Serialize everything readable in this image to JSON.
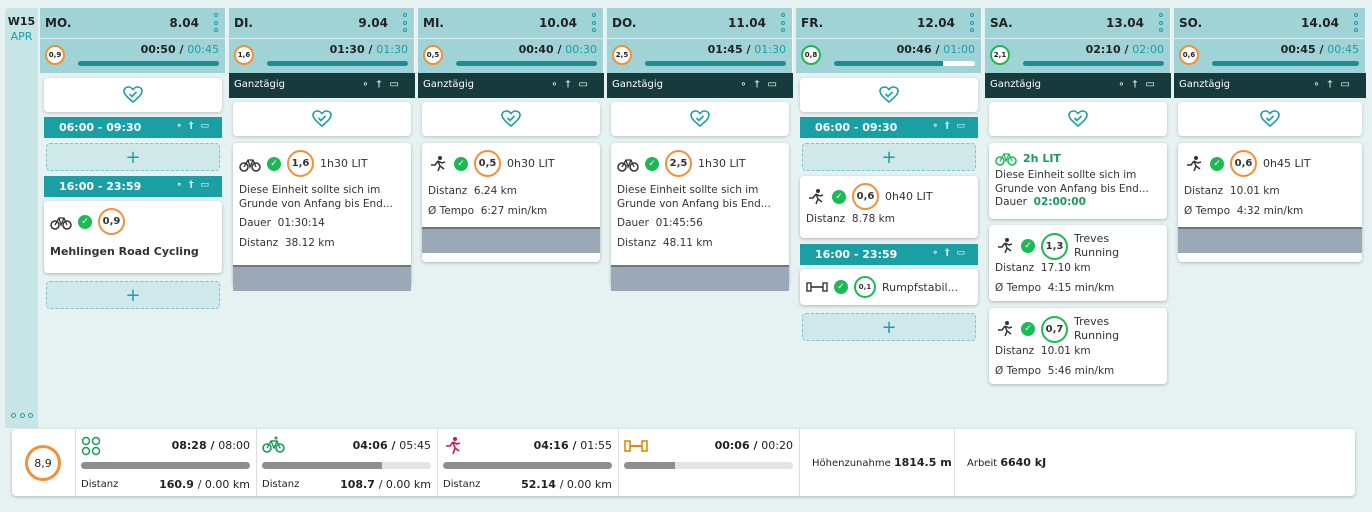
{
  "week": {
    "label": "W15",
    "month": "APR"
  },
  "days": [
    {
      "name": "MO.",
      "date": "8.04",
      "badge": "0,9",
      "time": "00:50",
      "planned": "00:45",
      "progress": 1.0
    },
    {
      "name": "DI.",
      "date": "9.04",
      "badge": "1,6",
      "time": "01:30",
      "planned": "01:30",
      "progress": 1.0
    },
    {
      "name": "MI.",
      "date": "10.04",
      "badge": "0,5",
      "time": "00:40",
      "planned": "00:30",
      "progress": 1.0
    },
    {
      "name": "DO.",
      "date": "11.04",
      "badge": "2,5",
      "time": "01:45",
      "planned": "01:30",
      "progress": 1.0
    },
    {
      "name": "FR.",
      "date": "12.04",
      "badge": "0,8",
      "time": "00:46",
      "planned": "01:00",
      "progress": 0.77
    },
    {
      "name": "SA.",
      "date": "13.04",
      "badge": "2,1",
      "time": "02:10",
      "planned": "02:00",
      "progress": 1.0
    },
    {
      "name": "SO.",
      "date": "14.04",
      "badge": "0,6",
      "time": "00:45",
      "planned": "00:45",
      "progress": 1.0
    }
  ],
  "allday": {
    "label": "Ganztägig"
  },
  "slots": {
    "morning": "06:00 - 09:30",
    "evening": "16:00 - 23:59"
  },
  "cards": {
    "mo_ride": {
      "badge": "0,9",
      "title": "Mehlingen Road Cycling"
    },
    "di": {
      "badge": "1,6",
      "title": "1h30 LIT",
      "desc1": "Diese Einheit sollte sich im",
      "desc2": "Grunde von Anfang bis End...",
      "l1k": "Dauer",
      "l1v": "01:30:14",
      "l2k": "Distanz",
      "l2v": "38.12 km"
    },
    "mi": {
      "badge": "0,5",
      "title": "0h30 LIT",
      "l1k": "Distanz",
      "l1v": "6.24 km",
      "l2k": "Ø Tempo",
      "l2v": "6:27 min/km"
    },
    "do": {
      "badge": "2,5",
      "title": "1h30 LIT",
      "desc1": "Diese Einheit sollte sich im",
      "desc2": "Grunde von Anfang bis End...",
      "l1k": "Dauer",
      "l1v": "01:45:56",
      "l2k": "Distanz",
      "l2v": "48.11 km"
    },
    "fr_run": {
      "badge": "0,6",
      "title": "0h40 LIT",
      "l1k": "Distanz",
      "l1v": "8.78 km"
    },
    "fr_gym": {
      "badge": "0,1",
      "title": "Rumpfstabil..."
    },
    "sa_plan": {
      "title": "2h LIT",
      "desc1": "Diese Einheit sollte sich im",
      "desc2": "Grunde von Anfang bis End...",
      "l1k": "Dauer",
      "l1v": "02:00:00"
    },
    "sa_run1": {
      "badge": "1,3",
      "title1": "Treves",
      "title2": "Running",
      "l1k": "Distanz",
      "l1v": "17.10 km",
      "l2k": "Ø Tempo",
      "l2v": "4:15 min/km"
    },
    "sa_run2": {
      "badge": "0,7",
      "title1": "Treves",
      "title2": "Running",
      "l1k": "Distanz",
      "l1v": "10.01 km",
      "l2k": "Ø Tempo",
      "l2v": "5:46 min/km"
    },
    "so": {
      "badge": "0,6",
      "title": "0h45 LIT",
      "l1k": "Distanz",
      "l1v": "10.01 km",
      "l2k": "Ø Tempo",
      "l2v": "4:32 min/km"
    }
  },
  "footer": {
    "badge": "8,9",
    "all": {
      "time": "08:28",
      "planned": "08:00",
      "dist_label": "Distanz",
      "dist": "160.9",
      "dist_plan": "0.00 km",
      "progress": 1.0
    },
    "bike": {
      "time": "04:06",
      "planned": "05:45",
      "dist_label": "Distanz",
      "dist": "108.7",
      "dist_plan": "0.00 km",
      "progress": 0.71
    },
    "run": {
      "time": "04:16",
      "planned": "01:55",
      "dist_label": "Distanz",
      "dist": "52.14",
      "dist_plan": "0.00 km",
      "progress": 1.0
    },
    "gym": {
      "time": "00:06",
      "planned": "00:20",
      "progress": 0.3
    },
    "elev": {
      "label": "Höhenzunahme",
      "value": "1814.5 m"
    },
    "work": {
      "label": "Arbeit",
      "value": "6640 kJ"
    }
  },
  "colors": {
    "teal": "#1a9fa5",
    "dark": "#173b3d",
    "orange": "#f29038",
    "green": "#1db954",
    "header": "#9fd3d6"
  },
  "icons": {
    "sport": [
      "bike-icon",
      "run-icon",
      "gym-icon"
    ]
  }
}
